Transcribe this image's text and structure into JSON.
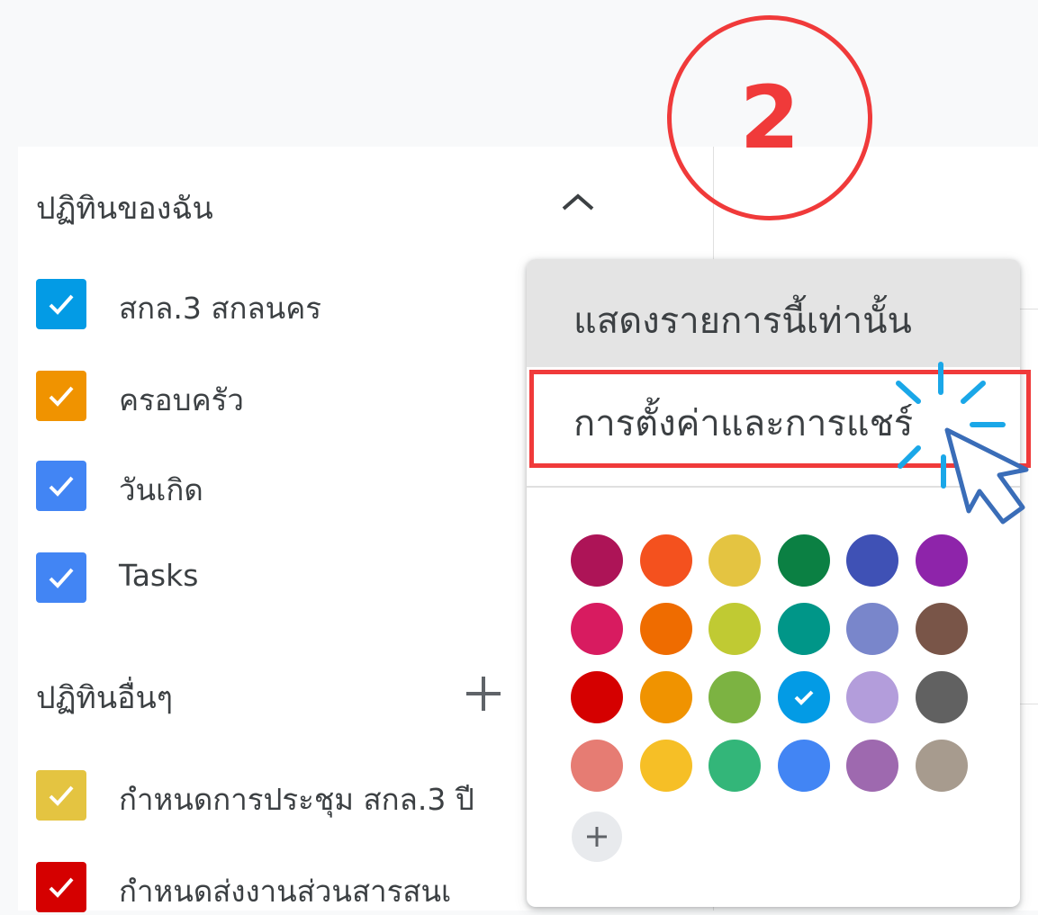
{
  "my_calendars": {
    "title": "ปฏิทินของฉัน",
    "toggle_icon": "chevron-up-icon",
    "items": [
      {
        "label": "สกล.3 สกลนคร",
        "color": "#039be5",
        "checked": true
      },
      {
        "label": "ครอบครัว",
        "color": "#f09300",
        "checked": true
      },
      {
        "label": "วันเกิด",
        "color": "#4285f4",
        "checked": true
      },
      {
        "label": "Tasks",
        "color": "#4285f4",
        "checked": true
      }
    ]
  },
  "other_calendars": {
    "title": "ปฏิทินอื่นๆ",
    "add_icon": "plus-icon",
    "items": [
      {
        "label": "กำหนดการประชุม สกล.3 ปี",
        "color": "#e4c441",
        "checked": true
      },
      {
        "label": "กำหนดส่งงานส่วนสารสนเ",
        "color": "#d50000",
        "checked": true
      }
    ]
  },
  "menu": {
    "show_only_this": "แสดงรายการนี้เท่านั้น",
    "settings_sharing": "การตั้งค่าและการแชร์",
    "selected_color": "#039be5",
    "colors": [
      [
        "#ad1457",
        "#f4511e",
        "#e4c441",
        "#0b8043",
        "#3f51b5",
        "#8e24aa"
      ],
      [
        "#d81b60",
        "#ef6c00",
        "#c0ca33",
        "#009688",
        "#7986cb",
        "#795548"
      ],
      [
        "#d50000",
        "#f09300",
        "#7cb342",
        "#039be5",
        "#b39ddb",
        "#616161"
      ],
      [
        "#e67c73",
        "#f6bf26",
        "#33b679",
        "#4285f4",
        "#9e69af",
        "#a79b8e"
      ]
    ],
    "add_color_icon": "plus-icon"
  },
  "annotation": {
    "step_number": "2",
    "highlight_color": "#f03a3a"
  }
}
